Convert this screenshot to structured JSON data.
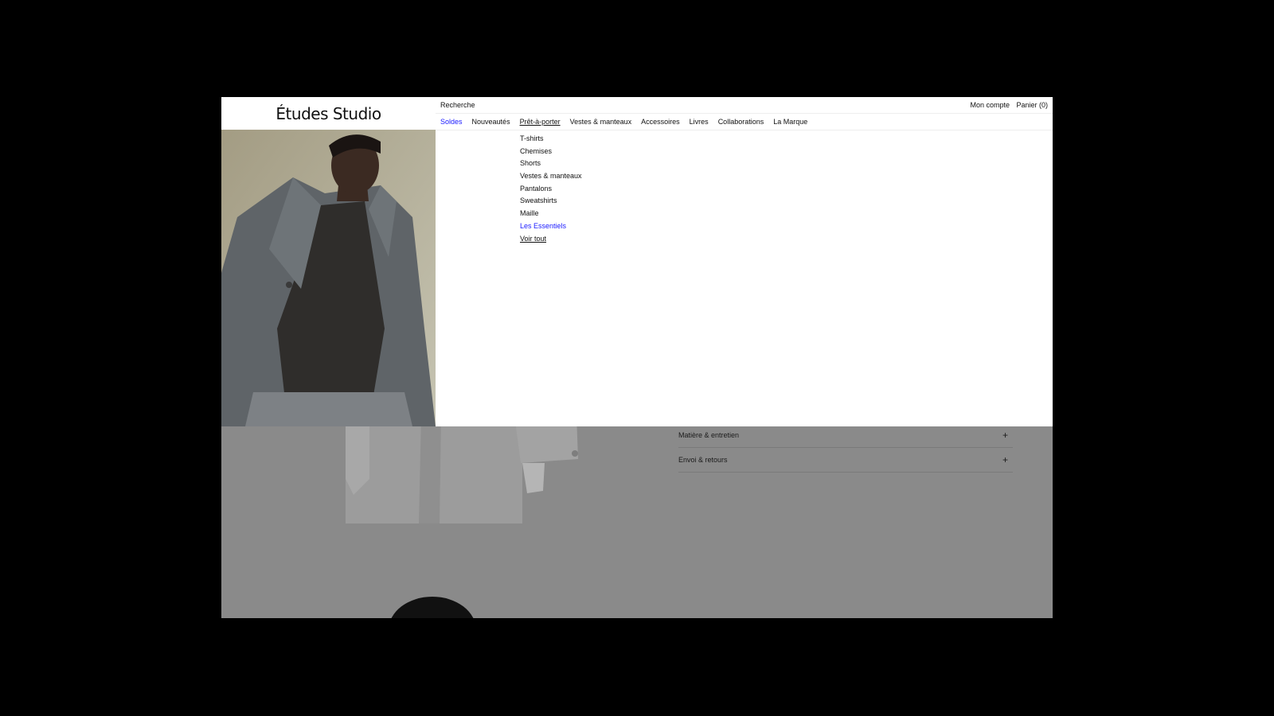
{
  "brand": {
    "name": "Études Studio"
  },
  "topbar": {
    "search": "Recherche",
    "account": "Mon compte",
    "cart": "Panier (0)"
  },
  "nav": {
    "items": [
      "Soldes",
      "Nouveautés",
      "Prêt-à-porter",
      "Vestes & manteaux",
      "Accessoires",
      "Livres",
      "Collaborations",
      "La Marque"
    ],
    "active": "Prêt-à-porter",
    "highlight_color": "#1a1aff"
  },
  "submenu": {
    "items": [
      "T-shirts",
      "Chemises",
      "Shorts",
      "Vestes & manteaux",
      "Pantalons",
      "Sweatshirts",
      "Maille",
      "Les Essentiels",
      "Voir tout"
    ]
  },
  "accordion": [
    {
      "label": "Matière & entretien",
      "icon": "plus-icon"
    },
    {
      "label": "Envoi & retours",
      "icon": "plus-icon"
    }
  ]
}
